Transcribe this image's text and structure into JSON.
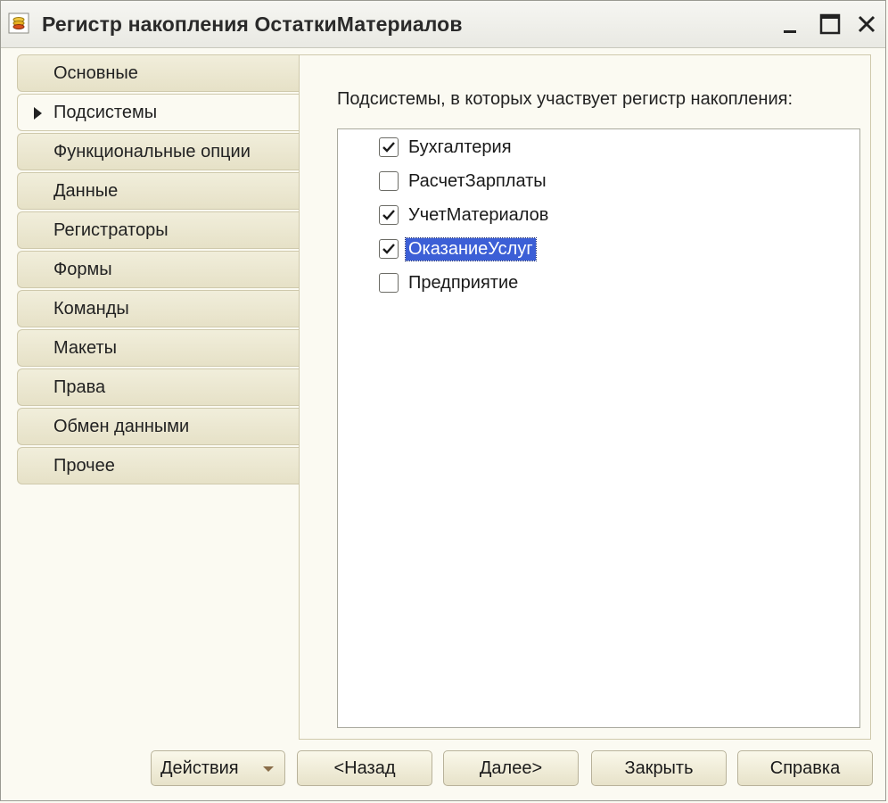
{
  "window": {
    "title": "Регистр накопления ОстаткиМатериалов",
    "icon": "accumulation-register-icon"
  },
  "sidebar": {
    "items": [
      {
        "label": "Основные",
        "active": false
      },
      {
        "label": "Подсистемы",
        "active": true
      },
      {
        "label": "Функциональные опции",
        "active": false
      },
      {
        "label": "Данные",
        "active": false
      },
      {
        "label": "Регистраторы",
        "active": false
      },
      {
        "label": "Формы",
        "active": false
      },
      {
        "label": "Команды",
        "active": false
      },
      {
        "label": "Макеты",
        "active": false
      },
      {
        "label": "Права",
        "active": false
      },
      {
        "label": "Обмен данными",
        "active": false
      },
      {
        "label": "Прочее",
        "active": false
      }
    ]
  },
  "content": {
    "prompt": "Подсистемы, в которых участвует регистр накопления:",
    "subsystems": [
      {
        "label": "Бухгалтерия",
        "checked": true,
        "selected": false
      },
      {
        "label": "РасчетЗарплаты",
        "checked": false,
        "selected": false
      },
      {
        "label": "УчетМатериалов",
        "checked": true,
        "selected": false
      },
      {
        "label": "ОказаниеУслуг",
        "checked": true,
        "selected": true
      },
      {
        "label": "Предприятие",
        "checked": false,
        "selected": false
      }
    ]
  },
  "buttons": {
    "actions": "Действия",
    "back": "<Назад",
    "next": "Далее>",
    "close": "Закрыть",
    "help": "Справка"
  },
  "colors": {
    "selection": "#3c5fd6",
    "tab_background": "#e6e1c7",
    "window_background": "#fbfaf2"
  }
}
